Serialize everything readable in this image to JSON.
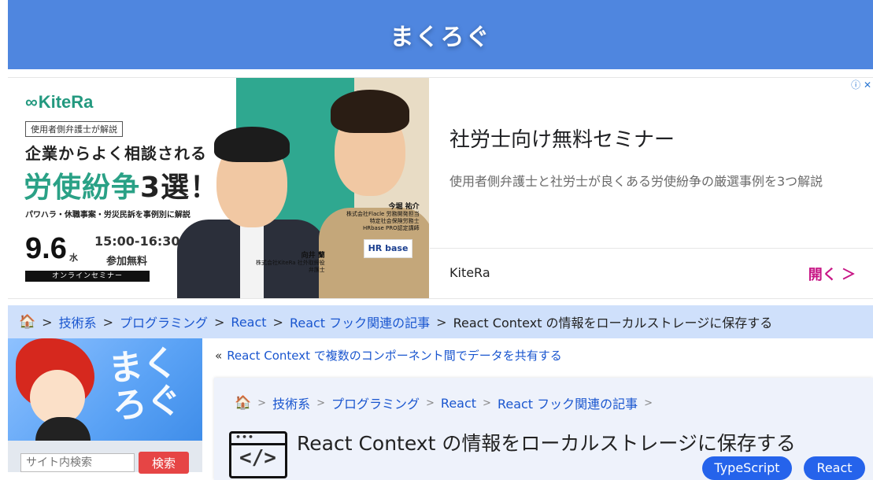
{
  "site": {
    "title": "まくろぐ"
  },
  "ad": {
    "banner": {
      "brand": "KiteRa",
      "tag": "使用者側弁護士が解説",
      "headline1": "企業からよく相談される",
      "headline2_a": "労使紛争",
      "headline2_b": "3選！",
      "subline": "パワハラ・休職事案・労災民訴を事例別に解説",
      "date": "9.6",
      "weekday": "水",
      "time": "15:00-16:30",
      "fee": "参加無料",
      "online": "オンラインセミナー",
      "speaker1_name": "今堀 祐介",
      "speaker1_info": [
        "株式会社Flacle 労務開発担当",
        "特定社会保険労務士",
        "HRbase PRO認定講師"
      ],
      "speaker2_name": "向井 蘭",
      "speaker2_info": [
        "株式会社KiteRa 社外取締役",
        "弁護士"
      ],
      "hr_logo": "HR base"
    },
    "title": "社労士向け無料セミナー",
    "description": "使用者側弁護士と社労士が良くある労使紛争の厳選事例を3つ解説",
    "advertiser": "KiteRa",
    "open_label": "開く ＞",
    "info_icons": "ⓘ ✕"
  },
  "breadcrumb": {
    "items": [
      "技術系",
      "プログラミング",
      "React",
      "React フック関連の記事"
    ],
    "current": "React Context の情報をローカルストレージに保存する",
    "separator": ">"
  },
  "sidebar": {
    "logo_text": "まく ろぐ",
    "search_placeholder": "サイト内検索",
    "search_button": "検索"
  },
  "main": {
    "prev_chevron": "«",
    "prev_link": "React Context で複数のコンポーネント間でデータを共有する",
    "article": {
      "breadcrumb": [
        "技術系",
        "プログラミング",
        "React",
        "React フック関連の記事"
      ],
      "title": "React Context の情報をローカルストレージに保存する",
      "tags": [
        "TypeScript",
        "React"
      ],
      "icon_dots": "•••",
      "icon_tag": "</>"
    }
  },
  "colors": {
    "header": "#4f86df",
    "breadcrumb_bg": "#cfe0fb",
    "link": "#1a56cf",
    "tag": "#2563eb",
    "search_button": "#e64545",
    "ad_open": "#c71585"
  },
  "icons": {
    "home": "home-icon",
    "code": "code-window-icon"
  }
}
